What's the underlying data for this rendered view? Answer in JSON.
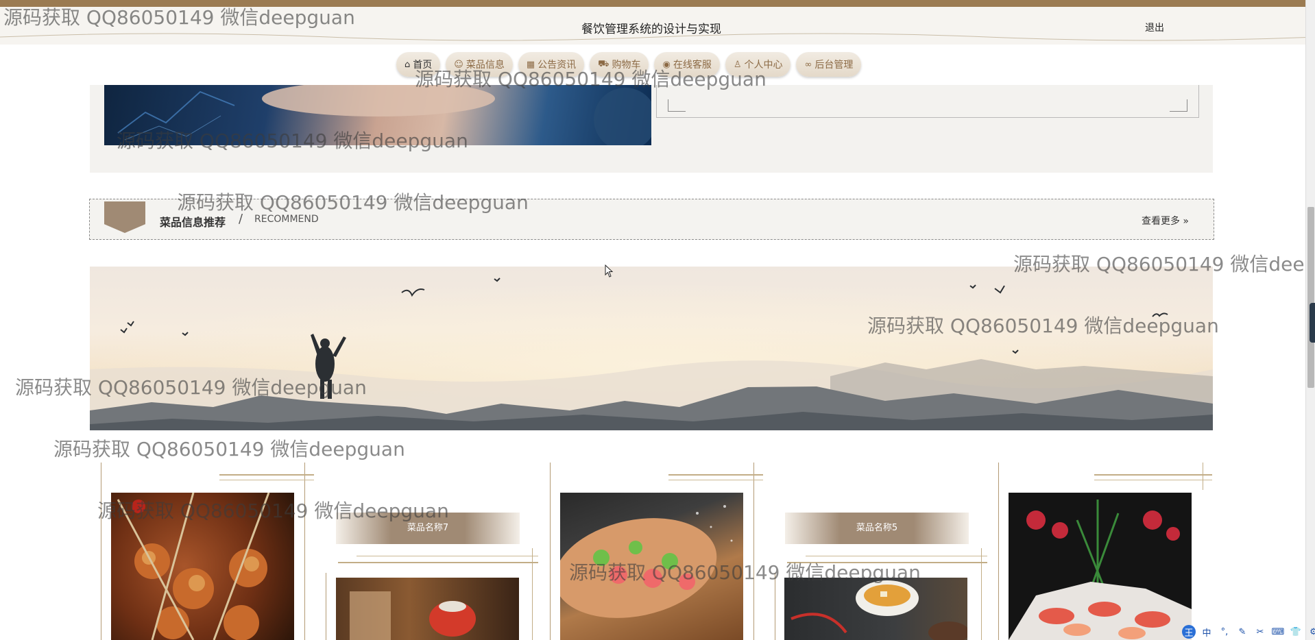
{
  "header": {
    "title": "餐饮管理系统的设计与实现",
    "logout_label": "退出"
  },
  "nav": {
    "items": [
      {
        "label": "首页",
        "icon": "home-icon",
        "glyph": "⌂"
      },
      {
        "label": "菜品信息",
        "icon": "dish-icon",
        "glyph": "☺"
      },
      {
        "label": "公告资讯",
        "icon": "notice-icon",
        "glyph": "▦"
      },
      {
        "label": "购物车",
        "icon": "cart-icon",
        "glyph": "⛟"
      },
      {
        "label": "在线客服",
        "icon": "chat-icon",
        "glyph": "◉"
      },
      {
        "label": "个人中心",
        "icon": "user-icon",
        "glyph": "♙"
      },
      {
        "label": "后台管理",
        "icon": "link-icon",
        "glyph": "∞"
      }
    ],
    "active_index": 0
  },
  "recommend": {
    "title": "菜品信息推荐",
    "separator": "/",
    "subtitle": "RECOMMEND",
    "view_more": "查看更多 »"
  },
  "dishes": {
    "tag_7": "菜品名称7",
    "tag_5": "菜品名称5"
  },
  "watermark": "源码获取 QQ86050149 微信deepguan",
  "ime": {
    "main": "王",
    "mode": "中",
    "keys": [
      "°,",
      "✎",
      "✂",
      "⌨",
      "👕",
      "⚙"
    ]
  },
  "colors": {
    "accent": "#9b7b52",
    "tag": "#a08a74",
    "nav_text": "#8c6a45"
  }
}
